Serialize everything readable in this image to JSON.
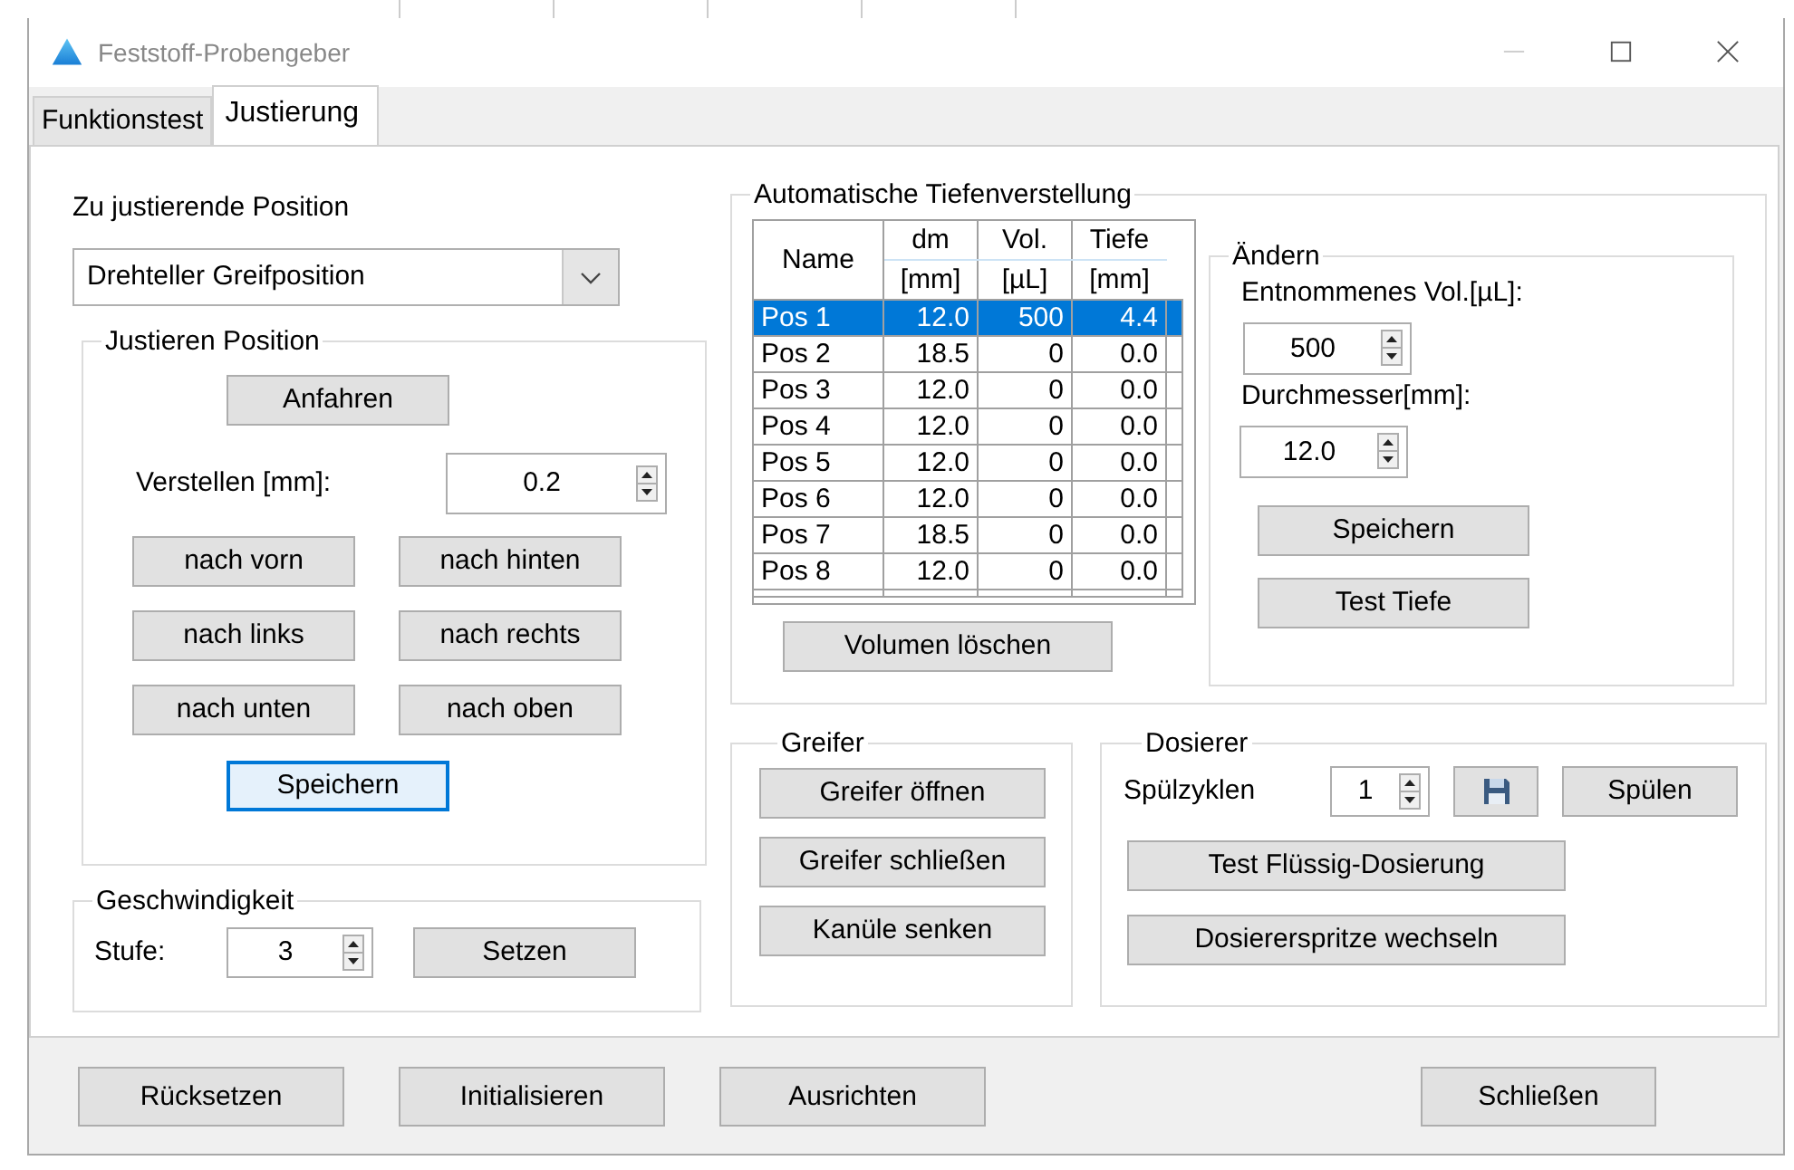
{
  "window": {
    "title": "Feststoff-Probengeber"
  },
  "tabs": [
    {
      "label": "Funktionstest",
      "selected": false
    },
    {
      "label": "Justierung",
      "selected": true
    }
  ],
  "position": {
    "label": "Zu justierende Position",
    "value": "Drehteller Greifposition"
  },
  "adjust": {
    "title": "Justieren Position",
    "move_button": "Anfahren",
    "step_label": "Verstellen [mm]:",
    "step_value": "0.2",
    "direction_buttons": [
      "nach vorn",
      "nach hinten",
      "nach links",
      "nach rechts",
      "nach unten",
      "nach oben"
    ],
    "save_button": {
      "label": "Speichern",
      "focused": true
    }
  },
  "speed": {
    "title": "Geschwindigkeit",
    "label": "Stufe:",
    "value": "3",
    "button": "Setzen"
  },
  "depth": {
    "title": "Automatische Tiefenverstellung",
    "table": {
      "columns": [
        {
          "label": "Name"
        },
        {
          "label": "dm",
          "unit": "[mm]"
        },
        {
          "label": "Vol.",
          "unit": "[µL]"
        },
        {
          "label": "Tiefe",
          "unit": "[mm]"
        }
      ],
      "rows": [
        {
          "cells": [
            "Pos 1",
            "12.0",
            "500",
            "4.4"
          ],
          "selected": true
        },
        {
          "cells": [
            "Pos 2",
            "18.5",
            "0",
            "0.0"
          ],
          "selected": false
        },
        {
          "cells": [
            "Pos 3",
            "12.0",
            "0",
            "0.0"
          ],
          "selected": false
        },
        {
          "cells": [
            "Pos 4",
            "12.0",
            "0",
            "0.0"
          ],
          "selected": false
        },
        {
          "cells": [
            "Pos 5",
            "12.0",
            "0",
            "0.0"
          ],
          "selected": false
        },
        {
          "cells": [
            "Pos 6",
            "12.0",
            "0",
            "0.0"
          ],
          "selected": false
        },
        {
          "cells": [
            "Pos 7",
            "18.5",
            "0",
            "0.0"
          ],
          "selected": false
        },
        {
          "cells": [
            "Pos 8",
            "12.0",
            "0",
            "0.0"
          ],
          "selected": false
        }
      ]
    },
    "clear_button": "Volumen löschen",
    "change": {
      "title": "Ändern",
      "fields": [
        {
          "label": "Entnommenes Vol.[µL]:",
          "value": "500"
        },
        {
          "label": "Durchmesser[mm]:",
          "value": "12.0"
        }
      ],
      "buttons": [
        "Speichern",
        "Test Tiefe"
      ]
    }
  },
  "gripper": {
    "title": "Greifer",
    "buttons": [
      "Greifer öffnen",
      "Greifer schließen",
      "Kanüle senken"
    ]
  },
  "doser": {
    "title": "Dosierer",
    "cycles_label": "Spülzyklen",
    "cycles_value": "1",
    "rinse_button": "Spülen",
    "buttons": [
      "Test Flüssig-Dosierung",
      "Dosiererspritze wechseln"
    ]
  },
  "footer_buttons": [
    {
      "label": "Rücksetzen",
      "kind": "left"
    },
    {
      "label": "Initialisieren",
      "kind": "left"
    },
    {
      "label": "Ausrichten",
      "kind": "left"
    },
    {
      "label": "Schließen",
      "kind": "right"
    }
  ]
}
